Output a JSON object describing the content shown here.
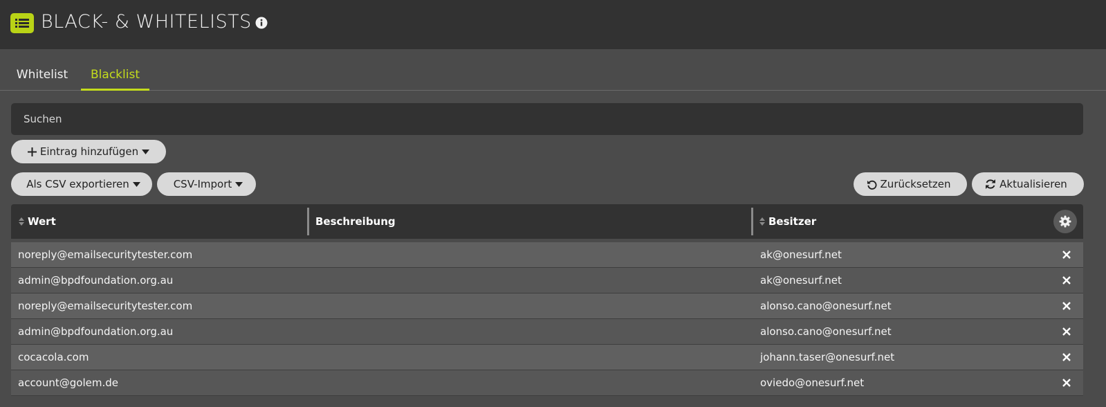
{
  "header": {
    "title": "BLACK- & WHITELISTS",
    "logo_icon": "list-icon",
    "info_icon": "info-icon",
    "accent_color": "#b9d316"
  },
  "tabs": [
    {
      "label": "Whitelist",
      "active": false
    },
    {
      "label": "Blacklist",
      "active": true
    }
  ],
  "search": {
    "placeholder": "Suchen",
    "value": ""
  },
  "toolbar": {
    "add_label": "Eintrag hinzufügen",
    "export_label": "Als CSV exportieren",
    "import_label": "CSV-Import",
    "reset_label": "Zurücksetzen",
    "refresh_label": "Aktualisieren"
  },
  "table": {
    "columns": [
      "Wert",
      "Beschreibung",
      "Besitzer"
    ],
    "rows": [
      {
        "wert": "noreply@emailsecuritytester.com",
        "beschreibung": "",
        "besitzer": "ak@onesurf.net"
      },
      {
        "wert": "admin@bpdfoundation.org.au",
        "beschreibung": "",
        "besitzer": "ak@onesurf.net"
      },
      {
        "wert": "noreply@emailsecuritytester.com",
        "beschreibung": "",
        "besitzer": "alonso.cano@onesurf.net"
      },
      {
        "wert": "admin@bpdfoundation.org.au",
        "beschreibung": "",
        "besitzer": "alonso.cano@onesurf.net"
      },
      {
        "wert": "cocacola.com",
        "beschreibung": "",
        "besitzer": "johann.taser@onesurf.net"
      },
      {
        "wert": "account@golem.de",
        "beschreibung": "",
        "besitzer": "oviedo@onesurf.net"
      }
    ]
  }
}
